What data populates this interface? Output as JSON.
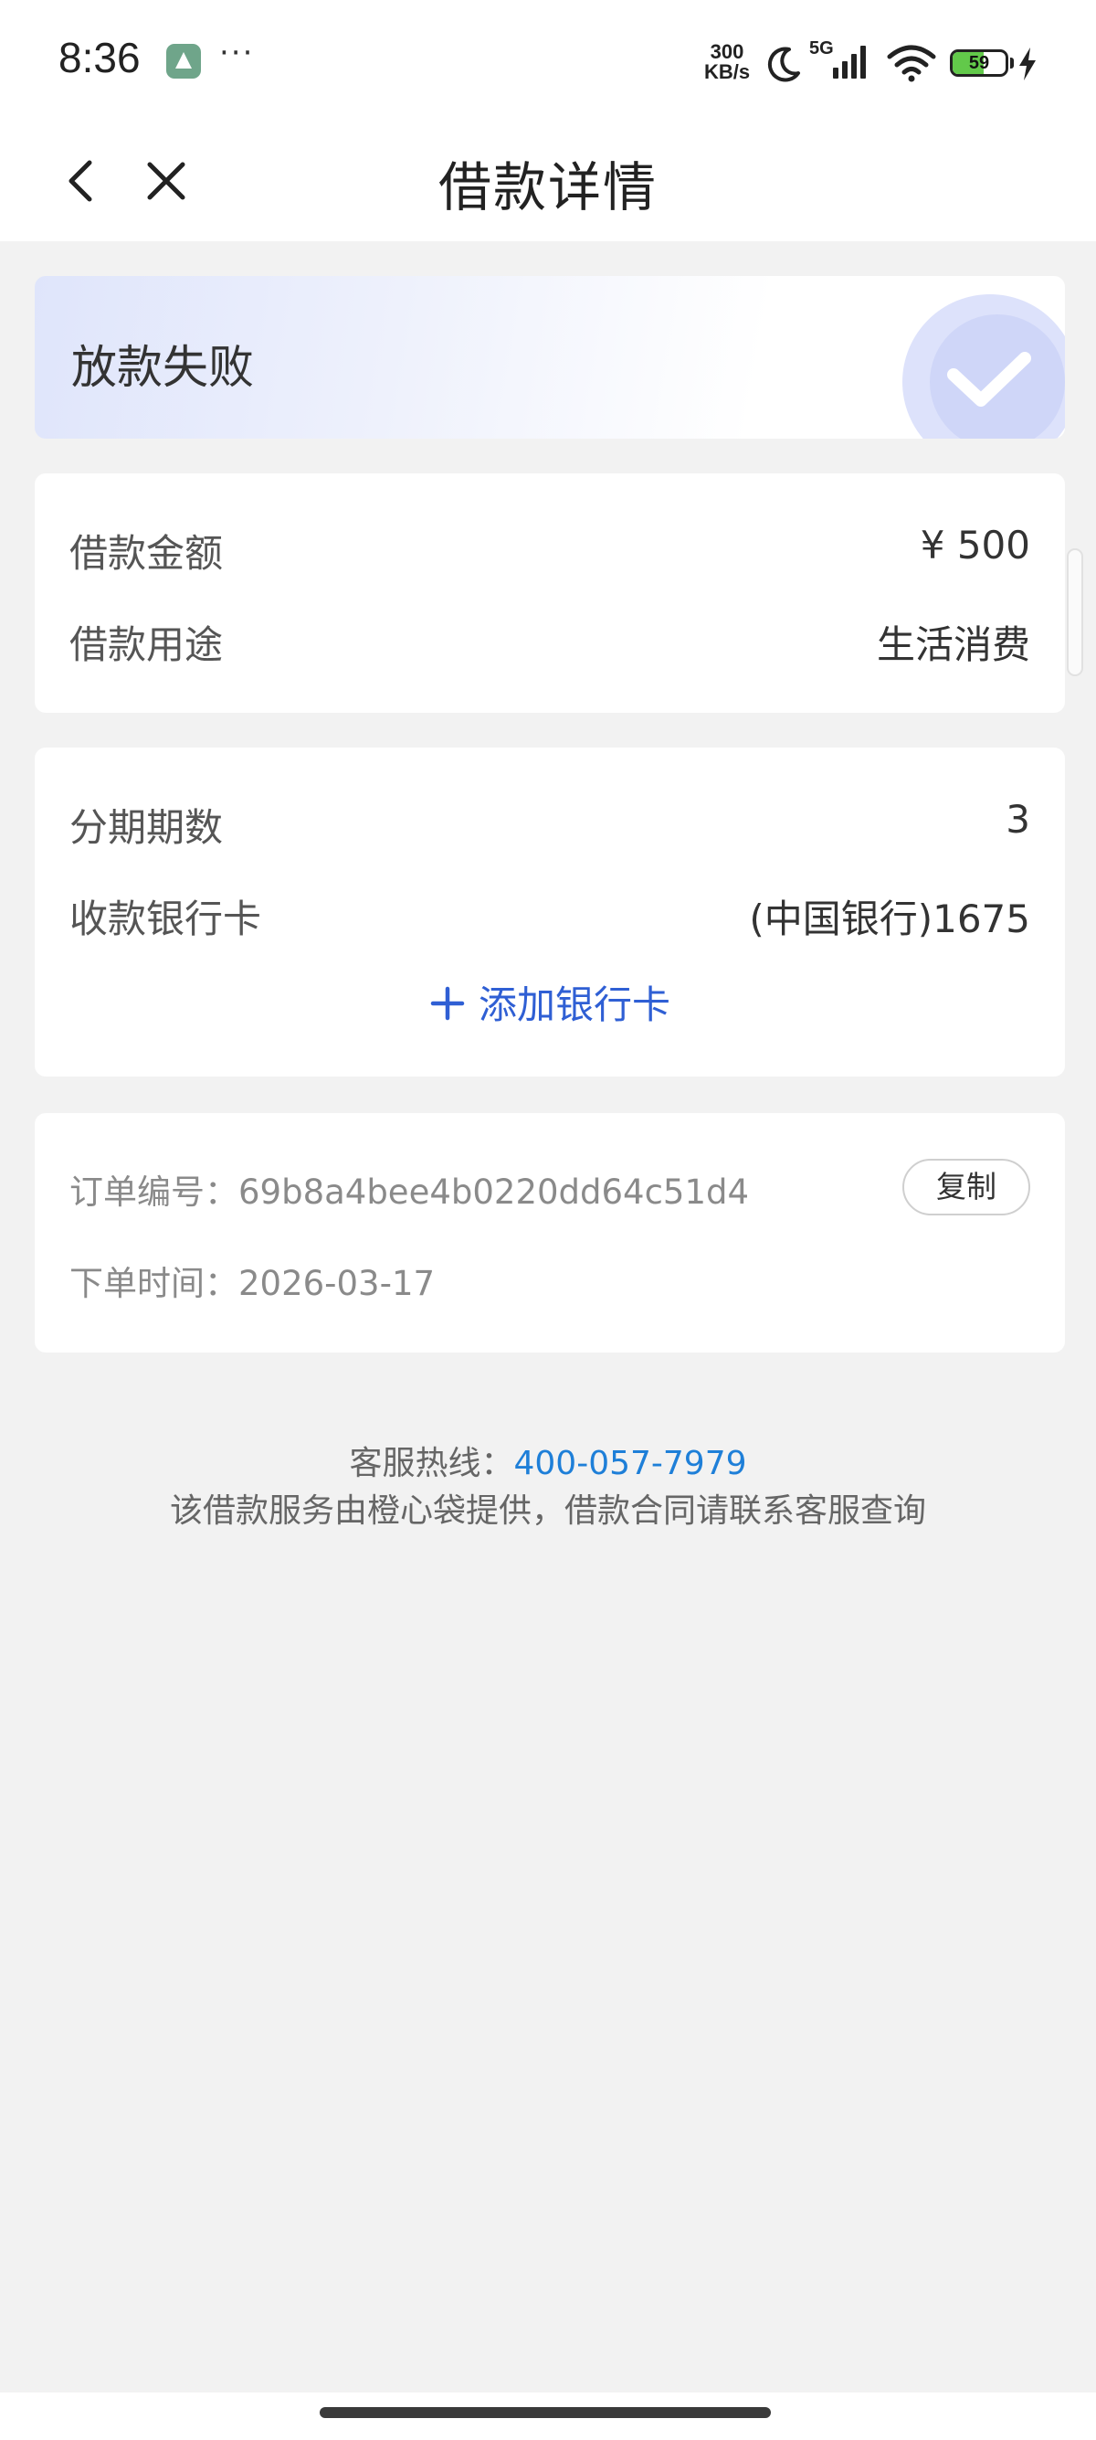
{
  "status_bar": {
    "time": "8:36",
    "more": "···",
    "net_speed_value": "300",
    "net_speed_unit": "KB/s",
    "signal_type": "5G",
    "battery": "59",
    "battery_level": 0.59
  },
  "nav": {
    "title": "借款详情"
  },
  "status_card": {
    "status": "放款失败"
  },
  "loan": {
    "amount_label": "借款金额",
    "amount_value": "¥ 500",
    "purpose_label": "借款用途",
    "purpose_value": "生活消费"
  },
  "installment": {
    "periods_label": "分期期数",
    "periods_value": "3",
    "bank_label": "收款银行卡",
    "bank_value": "(中国银行)1675",
    "add_card_label": "添加银行卡"
  },
  "order": {
    "number_label": "订单编号：",
    "number_value": "69b8a4bee4b0220dd64c51d4",
    "copy_label": "复制",
    "time_label": "下单时间：",
    "time_value": "2026-03-17"
  },
  "footer": {
    "hotline_label": "客服热线：",
    "hotline_number": "400-057-7979",
    "note": "该借款服务由橙心袋提供，借款合同请联系客服查询"
  },
  "colors": {
    "accent_blue": "#2f5fd4",
    "link_blue": "#1e7fd8",
    "battery_green": "#62c94a"
  }
}
